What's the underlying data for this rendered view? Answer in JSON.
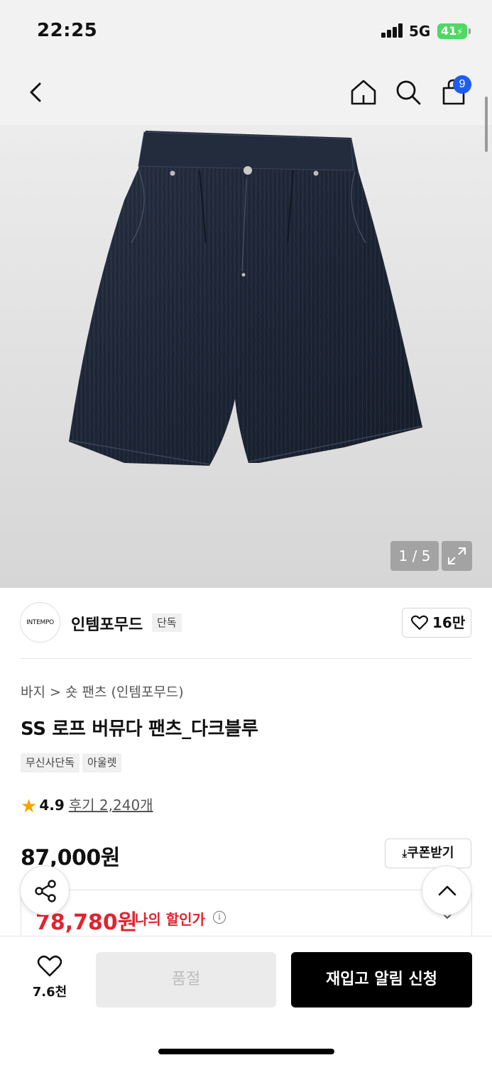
{
  "status_bar": {
    "time": "22:25",
    "network": "5G",
    "battery": "41"
  },
  "nav": {
    "cart_count": "9"
  },
  "gallery": {
    "counter": "1 / 5"
  },
  "brand": {
    "logo_text": "INTEMPO",
    "name": "인템포무드",
    "tag": "단독",
    "likes": "16만"
  },
  "product": {
    "breadcrumb": "바지 > 숏 팬츠 (인템포무드)",
    "title": "SS 로프 버뮤다 팬츠_다크블루",
    "tags": [
      "무신사단독",
      "아울렛"
    ],
    "rating": "4.9",
    "review_text": "후기 2,240개",
    "price": "87,000원",
    "coupon_label": "쿠폰받기",
    "discount_price": "78,780원",
    "discount_label": "나의 할인가"
  },
  "bottom": {
    "wish_count": "7.6천",
    "soldout_label": "품절",
    "restock_label": "재입고 알림 신청"
  },
  "colors": {
    "accent_red": "#e0242f",
    "badge_blue": "#1f5cf0",
    "star": "#f5a300"
  }
}
